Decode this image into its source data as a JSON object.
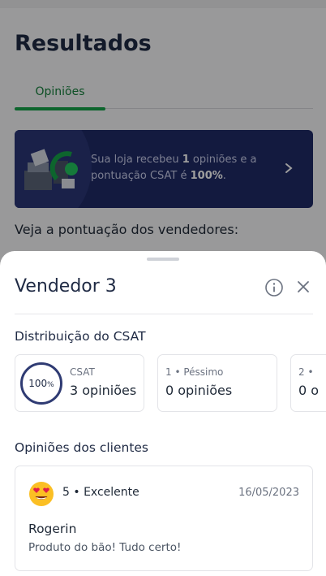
{
  "background": {
    "page_title": "Resultados",
    "tab_label": "Opiniões",
    "banner": {
      "text_prefix": "Sua loja recebeu ",
      "count": "1",
      "text_middle": " opiniões e a pontuação CSAT é ",
      "score": "100%",
      "text_suffix": "."
    },
    "section_heading": "Veja a pontuação dos vendedores:"
  },
  "sheet": {
    "title": "Vendedor 3",
    "csat_heading": "Distribuição do CSAT",
    "cards": [
      {
        "gauge_value": "100",
        "gauge_unit": "%",
        "label": "CSAT",
        "value": "3 opiniões"
      },
      {
        "label": "1 • Péssimo",
        "value": "0 opiniões"
      },
      {
        "label": "2 •",
        "value": "0 o"
      }
    ],
    "opinions_heading": "Opiniões dos clientes",
    "review": {
      "rating": "5 • Excelente",
      "date": "16/05/2023",
      "reviewer": "Rogerin",
      "comment": "Produto do bão! Tudo certo!"
    }
  },
  "colors": {
    "accent_green": "#16a34a",
    "banner_navy": "#1f2a66",
    "gauge_navy": "#2f3b73"
  },
  "icons": [
    "info-icon",
    "close-icon",
    "chevron-right-icon",
    "heart-eyes-emoji-icon"
  ]
}
